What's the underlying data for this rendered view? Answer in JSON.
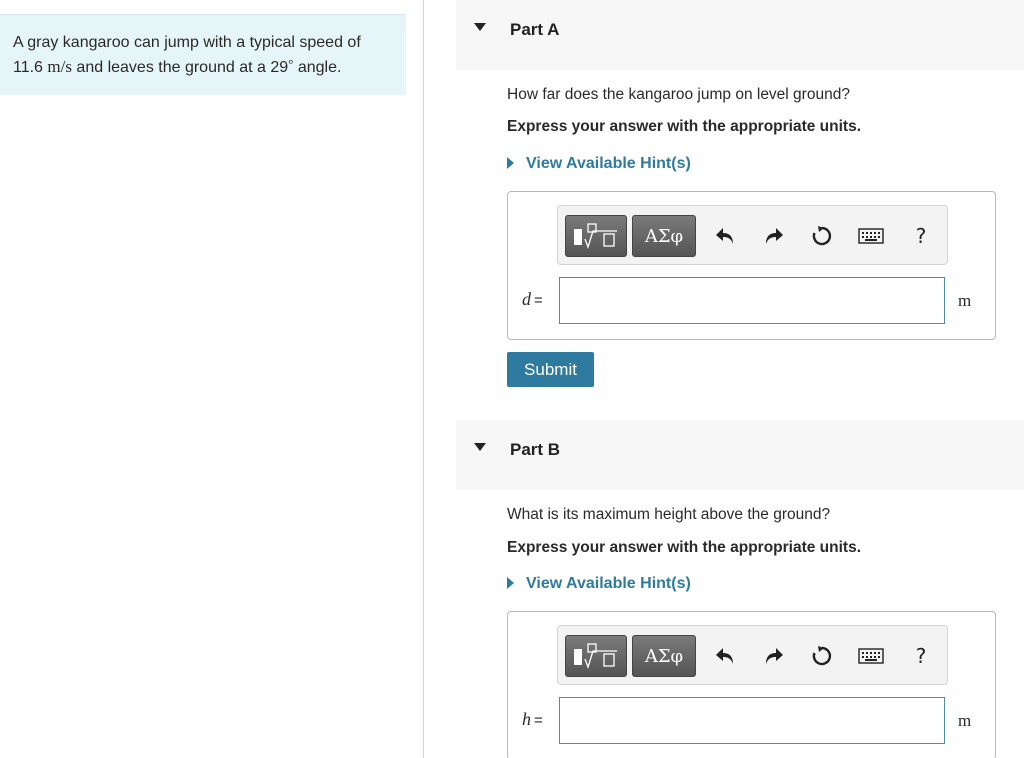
{
  "problem": {
    "text_before": "A gray kangaroo can jump with a typical speed of",
    "speed_value": "11.6",
    "speed_unit": "m/s",
    "text_mid": "and leaves the ground at a",
    "angle_value": "29",
    "angle_unit": "°",
    "text_after": "angle."
  },
  "part_a": {
    "title": "Part A",
    "question": "How far does the kangaroo jump on level ground?",
    "instruction": "Express your answer with the appropriate units.",
    "hint_label": "View Available Hint(s)",
    "variable": "d",
    "equals": "=",
    "input_value": "",
    "unit": "m",
    "submit_label": "Submit"
  },
  "part_b": {
    "title": "Part B",
    "question": "What is its maximum height above the ground?",
    "instruction": "Express your answer with the appropriate units.",
    "hint_label": "View Available Hint(s)",
    "variable": "h",
    "equals": "=",
    "input_value": "",
    "unit": "m"
  },
  "toolbar": {
    "greek_label": "ΑΣφ",
    "help_label": "?",
    "icons": [
      "templates-icon",
      "greek-letters-icon",
      "undo-icon",
      "redo-icon",
      "reset-icon",
      "keyboard-icon",
      "help-icon"
    ]
  },
  "colors": {
    "problem_bg": "#e6f5f7",
    "accent": "#2f7ba0",
    "header_bg": "#f7f7f7"
  }
}
